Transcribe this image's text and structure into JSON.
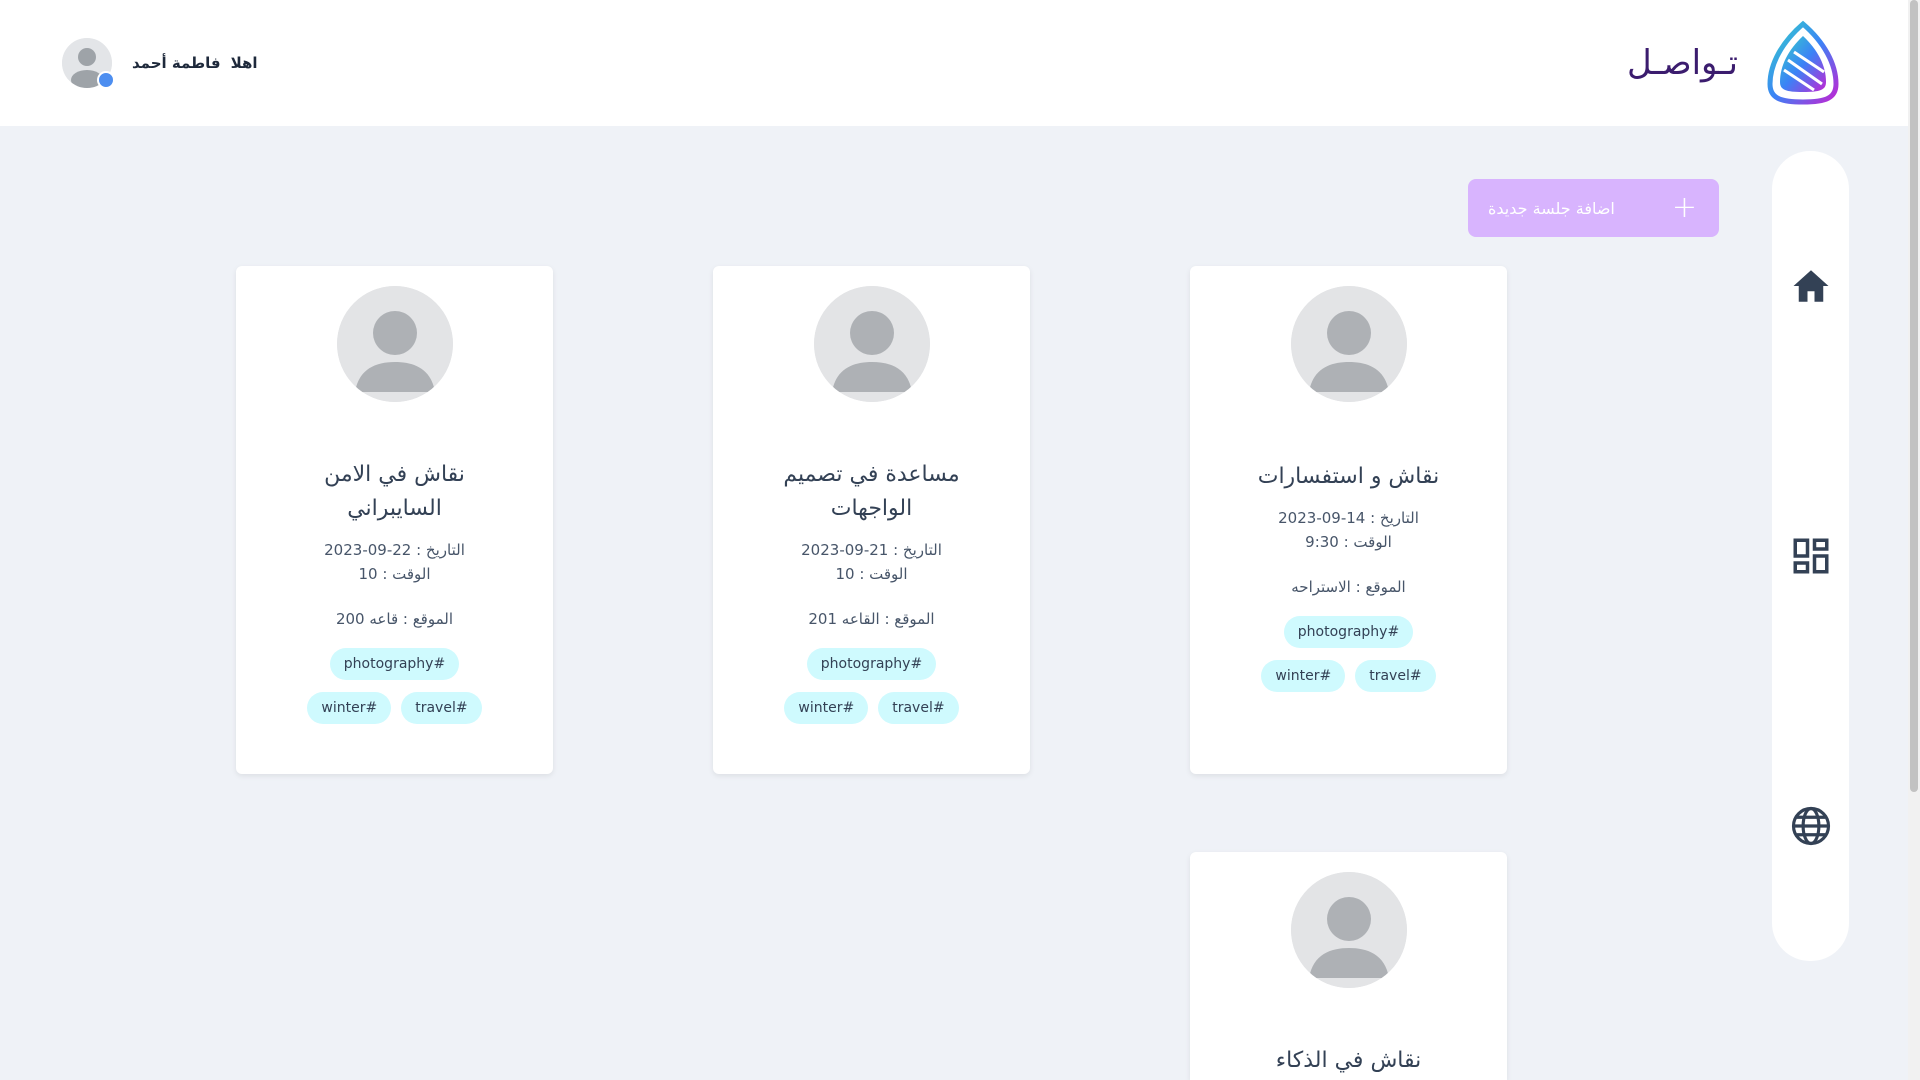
{
  "header": {
    "brand_name": "تـواصـل",
    "user": {
      "greeting": "اهلا",
      "name": "فاطمة أحمد"
    }
  },
  "actions": {
    "add_session_label": "اضافة جلسة جديدة",
    "add_icon": "+"
  },
  "nav": [
    "home-icon",
    "dashboard-icon",
    "globe-icon"
  ],
  "colors": {
    "accent": "#d8b4fe",
    "tag_bg": "#cffafe",
    "background": "#eff2f7",
    "online": "#4d8ef0"
  },
  "cards": [
    {
      "title": "نقاش و استفسارات",
      "date": "التاريخ : 14-09-2023",
      "time": "الوقت : 9:30",
      "location": "الموقع : الاستراحه",
      "tags": [
        "photography#",
        "travel#",
        "winter#"
      ]
    },
    {
      "title": "مساعدة في تصميم الواجهات",
      "date": "التاريخ : 21-09-2023",
      "time": "الوقت : 10",
      "location": "الموقع : القاعه 201",
      "tags": [
        "photography#",
        "travel#",
        "winter#"
      ]
    },
    {
      "title": "نقاش في الامن السايبراني",
      "date": "التاريخ : 22-09-2023",
      "time": "الوقت : 10",
      "location": "الموقع : قاعه 200",
      "tags": [
        "photography#",
        "travel#",
        "winter#"
      ]
    },
    {
      "title": "نقاش في الذكاء"
    }
  ]
}
